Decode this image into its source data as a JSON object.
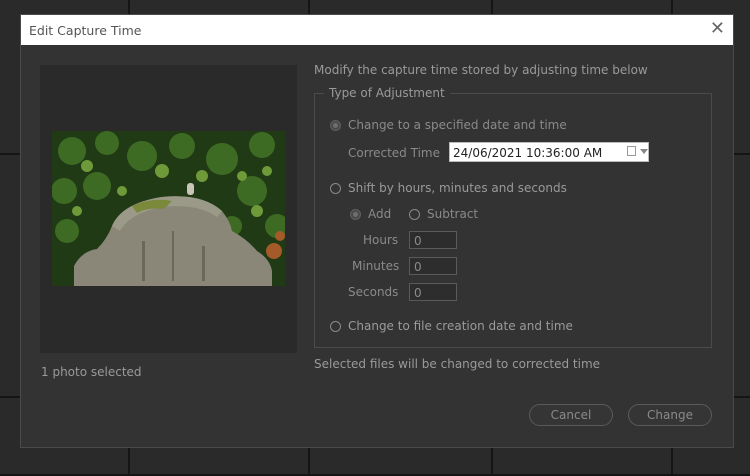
{
  "dialog": {
    "title": "Edit Capture Time",
    "close_icon": "close-icon"
  },
  "preview": {
    "selected_count": "1 photo selected"
  },
  "main": {
    "intro": "Modify the capture time stored by adjusting time below",
    "legend": "Type of Adjustment",
    "option_specified": "Change to a specified date and time",
    "corrected_time_label": "Corrected Time",
    "corrected_time_value": "24/06/2021  10:36:00 AM",
    "option_shift": "Shift by hours, minutes and seconds",
    "add_label": "Add",
    "subtract_label": "Subtract",
    "hours_label": "Hours",
    "hours_value": "0",
    "minutes_label": "Minutes",
    "minutes_value": "0",
    "seconds_label": "Seconds",
    "seconds_value": "0",
    "option_file_creation": "Change to file creation date and time",
    "note": "Selected files will be changed to corrected time"
  },
  "buttons": {
    "cancel": "Cancel",
    "change": "Change"
  },
  "colors": {
    "background": "#232323",
    "dialog": "#333333",
    "titlebar": "#ffffff"
  }
}
